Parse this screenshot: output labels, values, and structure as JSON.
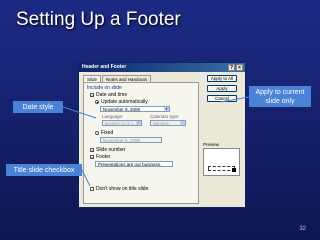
{
  "slide": {
    "title": "Setting Up a Footer",
    "page_number": "32"
  },
  "callouts": {
    "date_style": "Date style",
    "apply_current": "Apply to current slide only",
    "title_slide": "Title slide checkbox"
  },
  "dialog": {
    "title": "Header and Footer",
    "help_btn": "?",
    "close_btn": "×",
    "tabs": [
      "Slide",
      "Notes and Handouts"
    ],
    "include_label": "Include on slide",
    "date_time_label": "Date and time",
    "update_auto_label": "Update automatically",
    "date_value": "November 9, 2006",
    "language_label": "Language:",
    "calendar_label": "Calendar type:",
    "language_value": "English (U.S.)",
    "calendar_value": "Western",
    "fixed_label": "Fixed",
    "fixed_value": "November 9, 2006",
    "slide_number_label": "Slide number",
    "footer_label": "Footer",
    "footer_value": "Presentations are our business.",
    "dont_show_label": "Don't show on title slide",
    "apply_all_label": "Apply to All",
    "apply_label": "Apply",
    "cancel_label": "Cancel",
    "preview_label": "Preview"
  }
}
